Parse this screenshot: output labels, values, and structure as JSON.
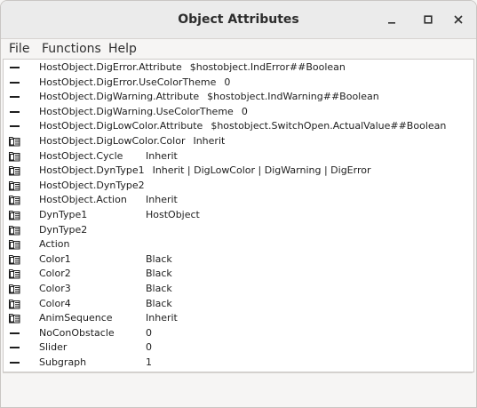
{
  "window": {
    "title": "Object Attributes",
    "minimize_glyph": "▁",
    "maximize_glyph": "▢",
    "close_glyph": "✕"
  },
  "menu": {
    "items": [
      "File",
      "Functions",
      "Help"
    ]
  },
  "attributes": [
    {
      "name": "HostObject.DigError.Attribute",
      "value": "$hostobject.IndError##Boolean",
      "icon": "attribute-icon",
      "inline": true
    },
    {
      "name": "HostObject.DigError.UseColorTheme",
      "value": "0",
      "icon": "attribute-icon",
      "inline": true
    },
    {
      "name": "HostObject.DigWarning.Attribute",
      "value": "$hostobject.IndWarning##Boolean",
      "icon": "attribute-icon",
      "inline": true
    },
    {
      "name": "HostObject.DigWarning.UseColorTheme",
      "value": "0",
      "icon": "attribute-icon",
      "inline": true
    },
    {
      "name": "HostObject.DigLowColor.Attribute",
      "value": "$hostobject.SwitchOpen.ActualValue##Boolean",
      "icon": "attribute-icon",
      "inline": true
    },
    {
      "name": "HostObject.DigLowColor.Color",
      "value": "Inherit",
      "icon": "enum-icon",
      "inline": true
    },
    {
      "name": "HostObject.Cycle",
      "value": "Inherit",
      "icon": "enum-icon",
      "inline": false
    },
    {
      "name": "HostObject.DynType1",
      "value": "Inherit | DigLowColor | DigWarning | DigError",
      "icon": "enum-icon",
      "inline": true
    },
    {
      "name": "HostObject.DynType2",
      "value": "",
      "icon": "enum-icon",
      "inline": false
    },
    {
      "name": "HostObject.Action",
      "value": "Inherit",
      "icon": "enum-icon",
      "inline": false
    },
    {
      "name": "DynType1",
      "value": "HostObject",
      "icon": "enum-icon",
      "inline": false
    },
    {
      "name": "DynType2",
      "value": "",
      "icon": "enum-icon",
      "inline": false
    },
    {
      "name": "Action",
      "value": "",
      "icon": "enum-icon",
      "inline": false
    },
    {
      "name": "Color1",
      "value": "Black",
      "icon": "enum-icon",
      "inline": false
    },
    {
      "name": "Color2",
      "value": "Black",
      "icon": "enum-icon",
      "inline": false
    },
    {
      "name": "Color3",
      "value": "Black",
      "icon": "enum-icon",
      "inline": false
    },
    {
      "name": "Color4",
      "value": "Black",
      "icon": "enum-icon",
      "inline": false
    },
    {
      "name": "AnimSequence",
      "value": "Inherit",
      "icon": "enum-icon",
      "inline": false
    },
    {
      "name": "NoConObstacle",
      "value": "0",
      "icon": "attribute-icon",
      "inline": false
    },
    {
      "name": "Slider",
      "value": "0",
      "icon": "attribute-icon",
      "inline": false
    },
    {
      "name": "Subgraph",
      "value": "1",
      "icon": "attribute-icon",
      "inline": false
    }
  ],
  "colors": {
    "text": "#1e1e1e",
    "list_background": "#ffffff",
    "window_background": "#f6f5f4",
    "titlebar_background": "#ebebeb"
  }
}
